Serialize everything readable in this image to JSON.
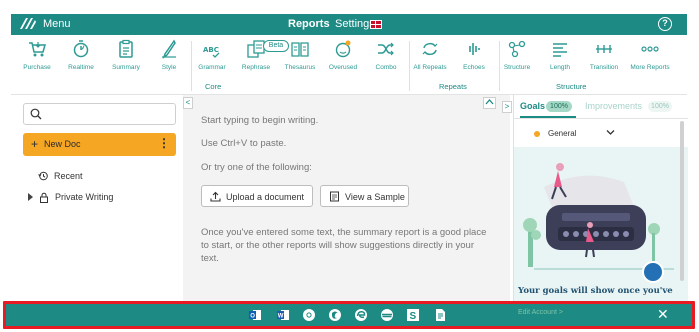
{
  "header": {
    "menu_label": "Menu",
    "nav_reports": "Reports",
    "nav_settings": "Settings",
    "help_symbol": "?"
  },
  "toolbar": {
    "beta_badge": "Beta",
    "tools": [
      {
        "label": "Purchase",
        "icon": "cart-icon"
      },
      {
        "label": "Realtime",
        "icon": "stopwatch-icon"
      },
      {
        "label": "Summary",
        "icon": "clipboard-icon"
      },
      {
        "label": "Style",
        "icon": "quill-icon"
      },
      {
        "label": "Grammar",
        "icon": "abc-check-icon"
      },
      {
        "label": "Rephrase",
        "icon": "rephrase-icon"
      },
      {
        "label": "Thesaurus",
        "icon": "book-icon"
      },
      {
        "label": "Overused",
        "icon": "overused-icon"
      },
      {
        "label": "Combo",
        "icon": "shuffle-icon"
      },
      {
        "label": "All Repeats",
        "icon": "repeat-icon"
      },
      {
        "label": "Echoes",
        "icon": "echo-icon"
      },
      {
        "label": "Structure",
        "icon": "structure-icon"
      },
      {
        "label": "Length",
        "icon": "length-icon"
      },
      {
        "label": "Transition",
        "icon": "transition-icon"
      },
      {
        "label": "More Reports",
        "icon": "more-icon"
      }
    ],
    "groups": {
      "core": "Core",
      "repeats": "Repeats",
      "structure": "Structure"
    }
  },
  "sidebar": {
    "new_doc_label": "New Doc",
    "new_doc_plus": "+",
    "kebab": "⋮",
    "recent_label": "Recent",
    "private_label": "Private Writing"
  },
  "editor": {
    "line1": "Start typing to begin writing.",
    "line2": "Use Ctrl+V to paste.",
    "line3": "Or try one of the following:",
    "upload_label": "Upload a document",
    "sample_label": "View a Sample",
    "summary_text": "Once you've entered some text, the summary report is a good place to start, or the other reports will show suggestions directly in your text.",
    "collapse_left": "<",
    "collapse_up": "^"
  },
  "right_panel": {
    "collapse_right": ">",
    "tab_goals": "Goals",
    "goals_pct": "100%",
    "tab_improvements": "Improvements",
    "improvements_pct": "100%",
    "goal_select_value": "General",
    "goals_message": "Your goals will show once you've"
  },
  "footer": {
    "close_symbol": "✕",
    "ghost_text": "Edit Account >",
    "icons": [
      "outlook-icon",
      "word-icon",
      "chrome-icon",
      "firefox-icon",
      "edge-icon",
      "opera-icon",
      "scrivener-icon",
      "google-docs-icon"
    ]
  },
  "colors": {
    "brand_teal": "#1d8a84",
    "accent_orange": "#f5a623",
    "highlight_red": "#e81b22"
  }
}
